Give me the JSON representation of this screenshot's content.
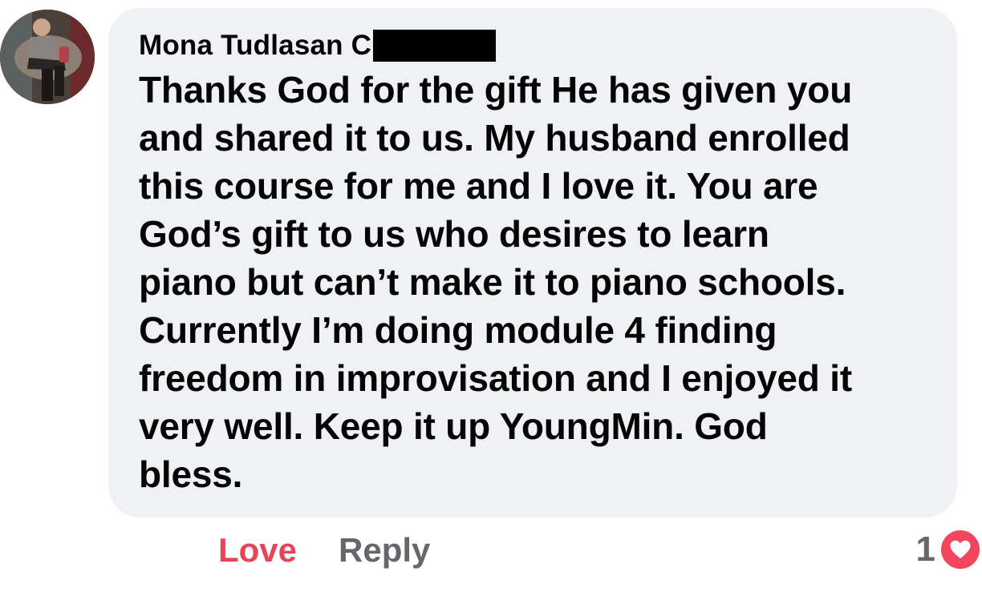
{
  "comment": {
    "author": "Mona Tudlasan C",
    "text": "Thanks God for the gift He has given you\nand shared it to us. My husband enrolled\nthis course for me and I love it. You are\nGod’s gift to us who desires to learn\npiano but can’t make it to piano schools.\nCurrently I’m doing module 4 finding\nfreedom in improvisation and I enjoyed it\nvery well. Keep it up YoungMin. God\nbless."
  },
  "actions": {
    "love_label": "Love",
    "reply_label": "Reply"
  },
  "reactions": {
    "count": "1",
    "icon": "heart-icon"
  },
  "colors": {
    "bubble_bg": "#f0f1f5",
    "love": "#e74458",
    "muted": "#65676b"
  }
}
